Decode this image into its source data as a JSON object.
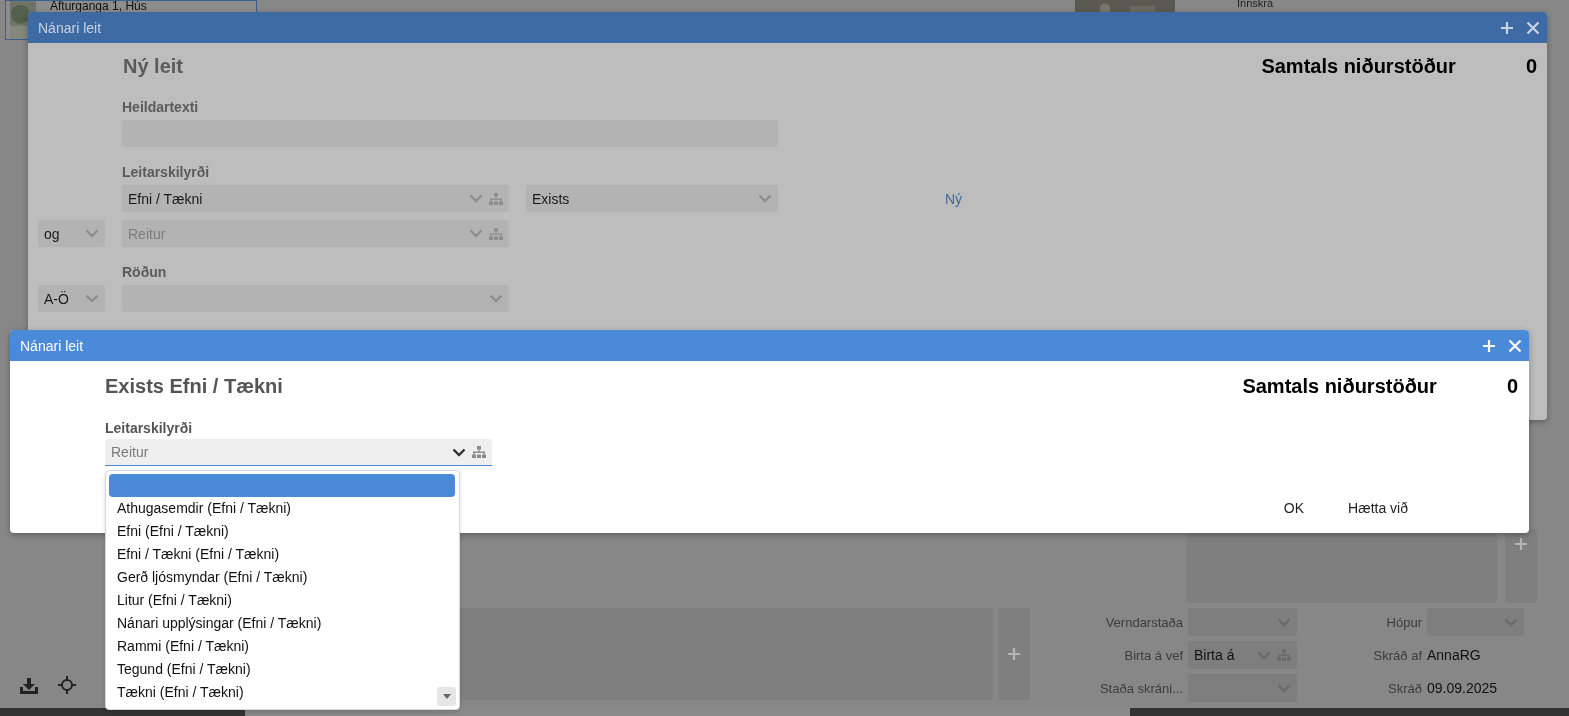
{
  "background": {
    "record_title": "Afturganga 1, Hús",
    "login": "Innskrá",
    "fields": [
      {
        "label": "Verndarstaða",
        "kind": "select"
      },
      {
        "label": "Hópur",
        "kind": "select"
      },
      {
        "label": "Birta á vef",
        "kind": "select_tree",
        "value": "Birta á"
      },
      {
        "label": "Skráð af",
        "kind": "text",
        "value": "AnnaRG"
      },
      {
        "label": "Staða skráni...",
        "kind": "select"
      },
      {
        "label": "Skráð",
        "kind": "text",
        "value": "09.09.2025"
      }
    ]
  },
  "search_dialog": {
    "title": "Nánari leit",
    "heading": "Ný leit",
    "results_label": "Samtals niðurstöður",
    "results_count": "0",
    "fulltext_label": "Heildartexti",
    "criteria_label": "Leitarskilyrði",
    "criteria": [
      {
        "field": "Efni / Tækni",
        "operator": "Exists"
      },
      {
        "connector": "og",
        "placeholder": "Reitur"
      }
    ],
    "new_link": "Ný",
    "sort_label": "Röðun",
    "sort_order": "A-Ö"
  },
  "sub_dialog": {
    "title": "Nánari leit",
    "heading": "Exists Efni / Tækni",
    "results_label": "Samtals niðurstöður",
    "results_count": "0",
    "criteria_label": "Leitarskilyrði",
    "field_placeholder": "Reitur",
    "expanded": true,
    "options": [
      {
        "selected": true
      },
      {
        "label": "Athugasemdir (Efni / Tækni)",
        "selected": false
      },
      {
        "label": "Efni (Efni / Tækni)",
        "selected": false
      },
      {
        "label": "Efni / Tækni (Efni / Tækni)",
        "selected": false
      },
      {
        "label": "Gerð ljósmyndar (Efni / Tækni)",
        "selected": false
      },
      {
        "label": "Litur (Efni / Tækni)",
        "selected": false
      },
      {
        "label": "Nánari upplýsingar (Efni / Tækni)",
        "selected": false
      },
      {
        "label": "Rammi (Efni / Tækni)",
        "selected": false
      },
      {
        "label": "Tegund (Efni / Tækni)",
        "selected": false
      },
      {
        "label": "Tækni (Efni / Tækni)",
        "selected": false
      }
    ],
    "buttons": [
      "OK",
      "Hætta við"
    ]
  }
}
